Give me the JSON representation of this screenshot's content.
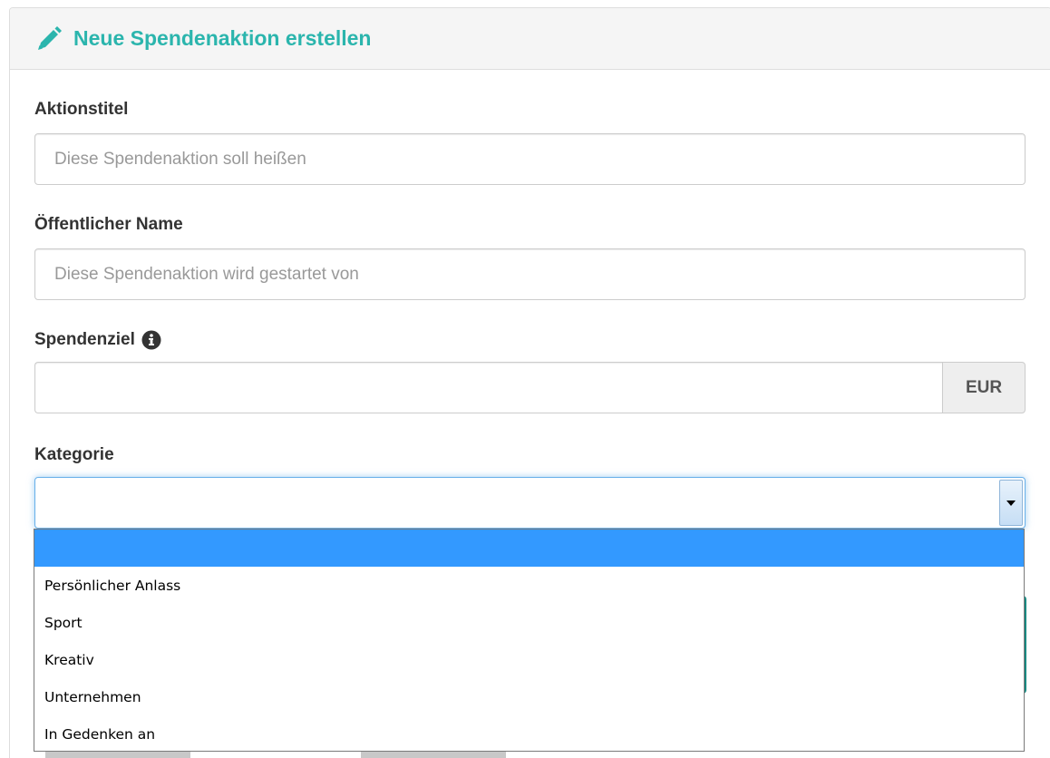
{
  "form": {
    "title": "Neue Spendenaktion erstellen",
    "title_icon": "pencil-icon",
    "accent_color": "#2bb5ad",
    "fields": {
      "title": {
        "label": "Aktionstitel",
        "value": "",
        "placeholder": "Diese Spendenaktion soll heißen"
      },
      "public_name": {
        "label": "Öffentlicher Name",
        "value": "",
        "placeholder": "Diese Spendenaktion wird gestartet von"
      },
      "goal": {
        "label": "Spendenziel",
        "value": "",
        "currency": "EUR",
        "info_icon": "info-circle-icon"
      },
      "category": {
        "label": "Kategorie",
        "selected": "",
        "options": [
          "",
          "Persönlicher Anlass",
          "Sport",
          "Kreativ",
          "Unternehmen",
          "In Gedenken an"
        ]
      }
    }
  }
}
